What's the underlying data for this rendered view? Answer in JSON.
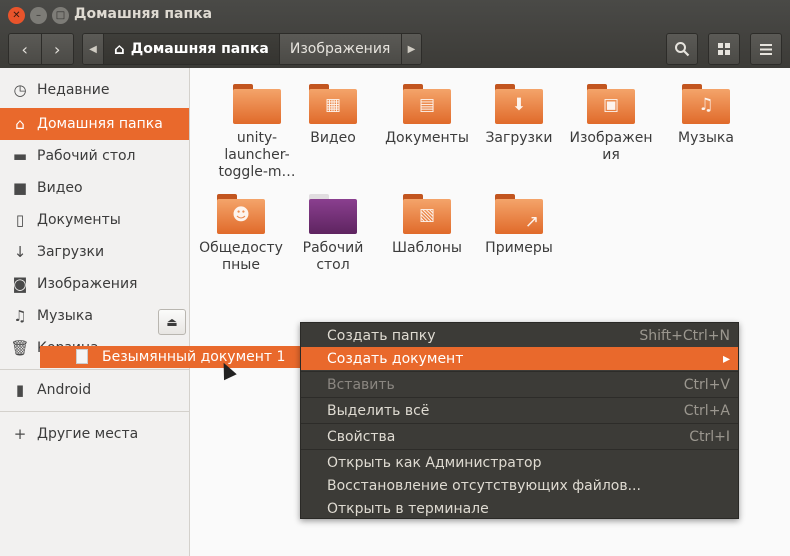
{
  "window": {
    "title": "Домашняя папка"
  },
  "toolbar": {
    "breadcrumb_current": "Домашняя папка",
    "breadcrumb_next": "Изображения",
    "icons": [
      "back-icon",
      "forward-icon",
      "search-icon",
      "grid-view-icon",
      "menu-icon"
    ]
  },
  "sidebar": {
    "items": [
      {
        "label": "Недавние",
        "icon": "clock-icon"
      },
      {
        "label": "Домашняя папка",
        "icon": "home-icon"
      },
      {
        "label": "Рабочий стол",
        "icon": "folder-icon"
      },
      {
        "label": "Видео",
        "icon": "video-icon"
      },
      {
        "label": "Документы",
        "icon": "document-icon"
      },
      {
        "label": "Загрузки",
        "icon": "download-icon"
      },
      {
        "label": "Изображения",
        "icon": "camera-icon"
      },
      {
        "label": "Музыка",
        "icon": "music-icon"
      },
      {
        "label": "Корзина",
        "icon": "trash-icon"
      }
    ],
    "devices": [
      {
        "label": "Android",
        "icon": "phone-icon"
      }
    ],
    "other": {
      "label": "Другие места"
    }
  },
  "files": [
    {
      "name": "unity-launcher-toggle-m…"
    },
    {
      "name": "Видео"
    },
    {
      "name": "Документы"
    },
    {
      "name": "Загрузки"
    },
    {
      "name": "Изображения"
    },
    {
      "name": "Музыка"
    },
    {
      "name": "Общедоступные"
    },
    {
      "name": "Рабочий стол"
    },
    {
      "name": "Шаблоны"
    },
    {
      "name": "Примеры"
    }
  ],
  "drag_item": {
    "label": "Безымянный документ 1"
  },
  "context_menu": {
    "items": [
      {
        "label": "Создать папку",
        "shortcut": "Shift+Ctrl+N"
      },
      {
        "label": "Создать документ",
        "shortcut": "▸"
      },
      {
        "label": "Вставить",
        "shortcut": "Ctrl+V"
      },
      {
        "label": "Выделить всё",
        "shortcut": "Ctrl+A"
      },
      {
        "label": "Свойства",
        "shortcut": "Ctrl+I"
      },
      {
        "label": "Открыть как Администратор",
        "shortcut": ""
      },
      {
        "label": "Восстановление отсутствующих файлов...",
        "shortcut": ""
      },
      {
        "label": "Открыть в терминале",
        "shortcut": ""
      }
    ]
  },
  "colors": {
    "accent": "#e9692c",
    "titlebar": "#3c3b37",
    "menu_bg": "#3c3b37"
  }
}
